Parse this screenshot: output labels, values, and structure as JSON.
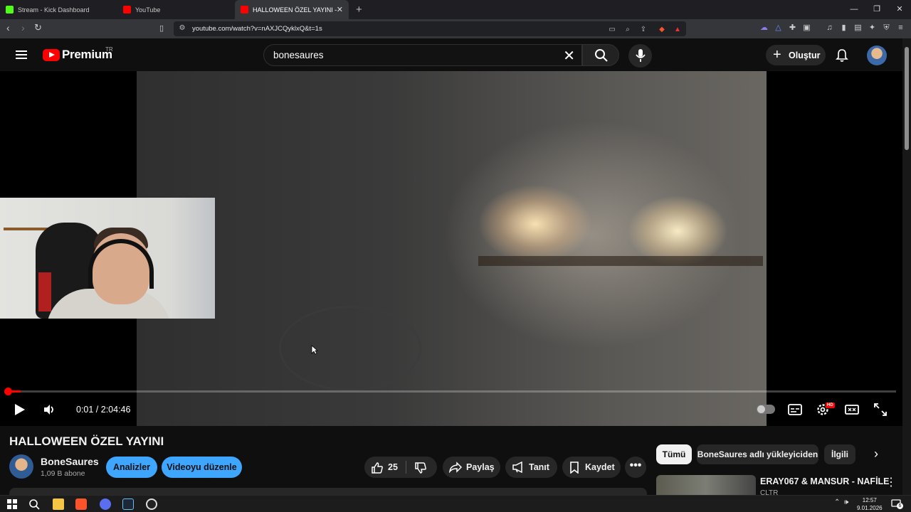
{
  "browser": {
    "tabs": [
      {
        "title": "Stream - Kick Dashboard",
        "color": "#53fc18"
      },
      {
        "title": "YouTube",
        "color": "#ff0000"
      },
      {
        "title": "HALLOWEEN ÖZEL YAYINI - You",
        "color": "#ff0000"
      }
    ],
    "url": "youtube.com/watch?v=nAXJCQyklxQ&t=1s"
  },
  "header": {
    "logo_text": "Premium",
    "region": "TR",
    "search_value": "bonesaures",
    "create_label": "Oluştur"
  },
  "player": {
    "time": "0:01 / 2:04:46",
    "progress_fraction": 0.0001,
    "settings_badge": "HD",
    "accent": "#ff0000"
  },
  "video": {
    "title": "HALLOWEEN ÖZEL YAYINI",
    "channel": "BoneSaures",
    "subscribers": "1,09 B abone",
    "buttons": {
      "analytics": "Analizler",
      "edit": "Videoyu düzenle",
      "likes": "25",
      "share": "Paylaş",
      "promote": "Tanıt",
      "save": "Kaydet"
    }
  },
  "sidebar": {
    "chips": [
      "Tümü",
      "BoneSaures adlı yükleyiciden",
      "İlgili"
    ],
    "recommendation": {
      "title": "ERAY067 & MANSUR - NAFİLE",
      "channel": "CLTR"
    }
  },
  "taskbar": {
    "time": "12:57",
    "date": "9.01.2026",
    "notification_count": "6"
  }
}
